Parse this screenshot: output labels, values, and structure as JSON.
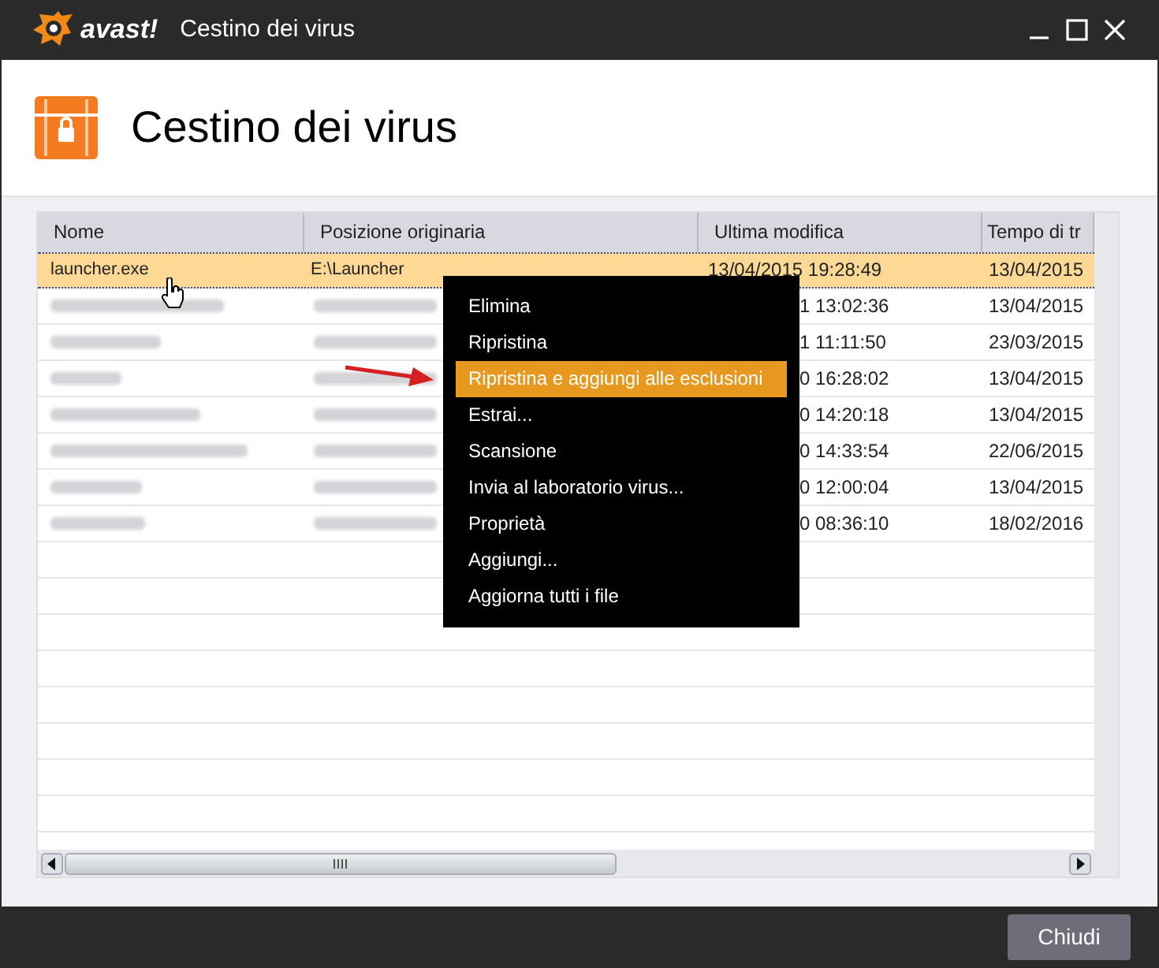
{
  "window": {
    "title": "Cestino dei virus",
    "logo": "avast!"
  },
  "header": {
    "title": "Cestino dei virus"
  },
  "table": {
    "columns": [
      "Nome",
      "Posizione originaria",
      "Ultima modifica",
      "Tempo di tr"
    ],
    "rows": [
      {
        "name": "launcher.exe",
        "location": "E:\\Launcher",
        "modified": "13/04/2015 19:28:49",
        "quarantined": "13/04/2015",
        "selected": true,
        "blurred": false
      },
      {
        "modified": "1 13:02:36",
        "quarantined": "13/04/2015",
        "selected": false,
        "blurred": true
      },
      {
        "modified": "1 11:11:50",
        "quarantined": "23/03/2015",
        "selected": false,
        "blurred": true
      },
      {
        "modified": "0 16:28:02",
        "quarantined": "13/04/2015",
        "selected": false,
        "blurred": true
      },
      {
        "modified": "0 14:20:18",
        "quarantined": "13/04/2015",
        "selected": false,
        "blurred": true
      },
      {
        "modified": "0 14:33:54",
        "quarantined": "22/06/2015",
        "selected": false,
        "blurred": true
      },
      {
        "modified": "0 12:00:04",
        "quarantined": "13/04/2015",
        "selected": false,
        "blurred": true
      },
      {
        "modified": "0 08:36:10",
        "quarantined": "18/02/2016",
        "selected": false,
        "blurred": true
      }
    ]
  },
  "context_menu": [
    {
      "label": "Elimina",
      "selected": false
    },
    {
      "label": "Ripristina",
      "selected": false
    },
    {
      "label": "Ripristina e aggiungi alle esclusioni",
      "selected": true
    },
    {
      "label": "Estrai...",
      "selected": false
    },
    {
      "label": "Scansione",
      "selected": false
    },
    {
      "label": "Invia al laboratorio virus...",
      "selected": false
    },
    {
      "label": "Proprietà",
      "selected": false
    },
    {
      "label": "Aggiungi...",
      "selected": false
    },
    {
      "label": "Aggiorna tutti i file",
      "selected": false
    }
  ],
  "buttons": [
    "Chiudi"
  ]
}
